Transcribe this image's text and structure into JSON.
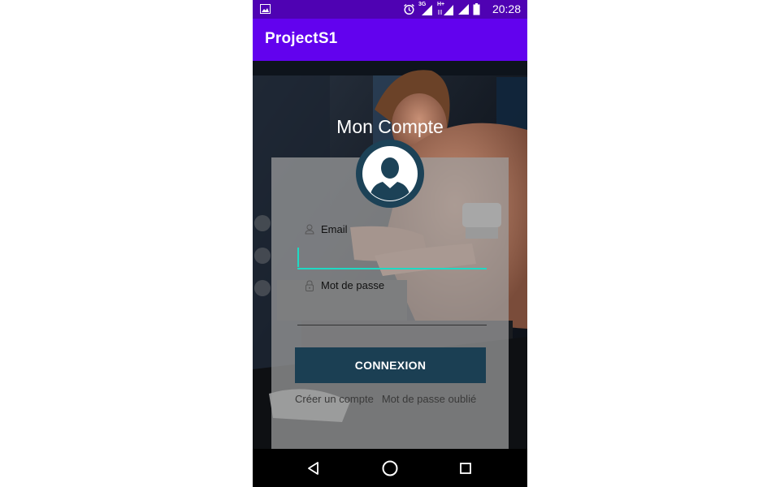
{
  "status_bar": {
    "time": "20:28",
    "network_3g": "3G",
    "network_hplus": "H+",
    "icons": [
      "gallery-icon",
      "alarm-icon",
      "signal-3g-icon",
      "signal-hplus-icon",
      "signal-icon",
      "battery-icon"
    ]
  },
  "app_bar": {
    "title": "ProjectS1"
  },
  "login": {
    "heading": "Mon Compte",
    "email_label": "Email",
    "email_value": "",
    "password_label": "Mot de passe",
    "password_value": "",
    "submit_label": "CONNEXION",
    "create_account_link": "Créer un compte",
    "forgot_password_link": "Mot de passe oublié"
  },
  "colors": {
    "status_bar": "#4f02b3",
    "app_bar": "#6202ee",
    "button": "#1b3f53",
    "avatar": "#1c4257",
    "field_accent": "#1fd9c4"
  },
  "nav_bar": {
    "icons": [
      "back-icon",
      "home-icon",
      "recents-icon"
    ]
  }
}
